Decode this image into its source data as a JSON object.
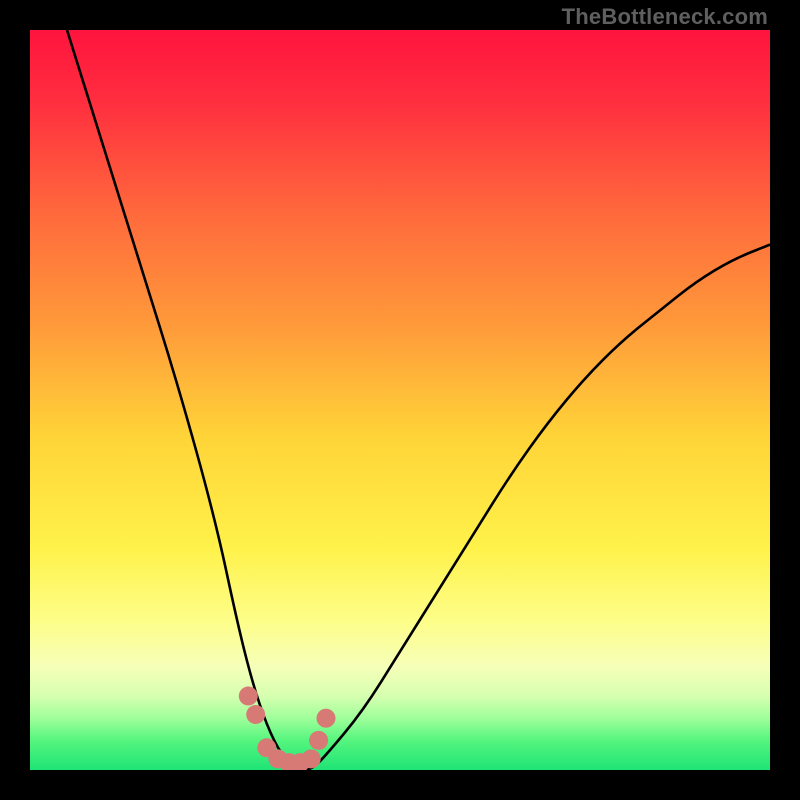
{
  "watermark": "TheBottleneck.com",
  "chart_data": {
    "type": "line",
    "title": "",
    "xlabel": "",
    "ylabel": "",
    "xlim": [
      0,
      100
    ],
    "ylim": [
      0,
      100
    ],
    "series": [
      {
        "name": "bottleneck-curve",
        "x": [
          5,
          10,
          15,
          20,
          25,
          28,
          30,
          32,
          34,
          36,
          38,
          40,
          45,
          50,
          55,
          60,
          65,
          70,
          75,
          80,
          85,
          90,
          95,
          100
        ],
        "y": [
          100,
          84,
          68,
          52,
          34,
          20,
          12,
          6,
          2,
          0,
          0,
          2,
          8,
          16,
          24,
          32,
          40,
          47,
          53,
          58,
          62,
          66,
          69,
          71
        ]
      }
    ],
    "markers": {
      "name": "highlight-dots",
      "x": [
        29.5,
        30.5,
        32,
        33.5,
        35,
        36.5,
        38,
        39,
        40
      ],
      "y": [
        10,
        7.5,
        3,
        1.5,
        1,
        1,
        1.5,
        4,
        7
      ]
    },
    "background_gradient": {
      "stops": [
        {
          "pos": 0.0,
          "color": "#ff143e"
        },
        {
          "pos": 0.1,
          "color": "#ff2f3f"
        },
        {
          "pos": 0.25,
          "color": "#ff6a3c"
        },
        {
          "pos": 0.4,
          "color": "#ff9a3a"
        },
        {
          "pos": 0.55,
          "color": "#ffd438"
        },
        {
          "pos": 0.7,
          "color": "#fff24a"
        },
        {
          "pos": 0.8,
          "color": "#fdfe8a"
        },
        {
          "pos": 0.86,
          "color": "#f6ffb8"
        },
        {
          "pos": 0.9,
          "color": "#d6ffb0"
        },
        {
          "pos": 0.93,
          "color": "#9fff9a"
        },
        {
          "pos": 0.96,
          "color": "#55f57e"
        },
        {
          "pos": 1.0,
          "color": "#1ee476"
        }
      ]
    },
    "marker_color": "#d77a76",
    "curve_color": "#000000"
  }
}
